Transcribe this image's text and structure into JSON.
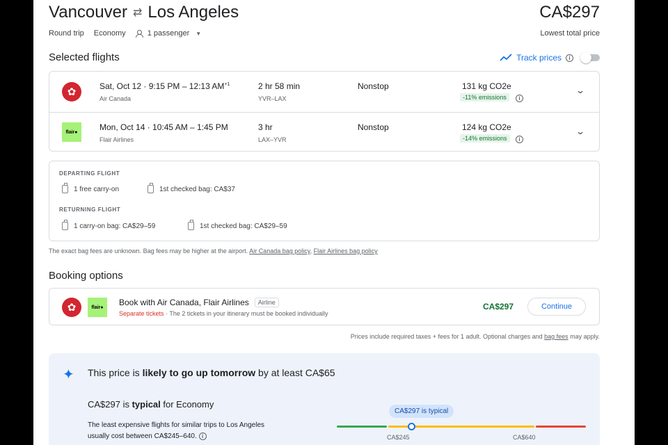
{
  "header": {
    "origin": "Vancouver",
    "destination": "Los Angeles",
    "swap_icon": "⇄",
    "price": "CA$297",
    "trip_type": "Round trip",
    "cabin": "Economy",
    "passengers": "1 passenger",
    "price_label": "Lowest total price"
  },
  "selected": {
    "title": "Selected flights",
    "track_label": "Track prices",
    "track_enabled": false,
    "flights": [
      {
        "date_time": "Sat, Oct 12 · 9:15 PM – 12:13 AM",
        "next_day": "+1",
        "airline": "Air Canada",
        "duration": "2 hr 58 min",
        "codes": "YVR–LAX",
        "stops": "Nonstop",
        "co2": "131 kg CO2e",
        "emissions": "-11% emissions",
        "logo": "air-canada-logo"
      },
      {
        "date_time": "Mon, Oct 14 · 10:45 AM – 1:45 PM",
        "next_day": "",
        "airline": "Flair Airlines",
        "duration": "3 hr",
        "codes": "LAX–YVR",
        "stops": "Nonstop",
        "co2": "124 kg CO2e",
        "emissions": "-14% emissions",
        "logo": "flair-logo"
      }
    ]
  },
  "logos": {
    "air_canada_glyph": "✿",
    "flair_text": "flair●"
  },
  "bags": {
    "departing_header": "DEPARTING FLIGHT",
    "departing_carry": "1 free carry-on",
    "departing_checked": "1st checked bag: CA$37",
    "returning_header": "RETURNING FLIGHT",
    "returning_carry": "1 carry-on bag: CA$29–59",
    "returning_checked": "1st checked bag: CA$29–59",
    "note": "The exact bag fees are unknown. Bag fees may be higher at the airport. ",
    "ac_policy": "Air Canada bag policy",
    "flair_policy": "Flair Airlines bag policy"
  },
  "booking": {
    "title": "Booking options",
    "book_with": "Book with Air Canada, Flair Airlines",
    "badge": "Airline",
    "separate": "Separate tickets",
    "separate_note": " · The 2 tickets in your itinerary must be booked individually",
    "price": "CA$297",
    "continue_label": "Continue",
    "fee_note_pre": "Prices include required taxes + fees for 1 adult. Optional charges and ",
    "fee_link": "bag fees",
    "fee_note_post": " may apply."
  },
  "insights": {
    "head_pre": "This price is ",
    "head_bold": "likely to go up tomorrow",
    "head_post": " by at least CA$65",
    "price_pre": "CA$297 is ",
    "price_bold": "typical",
    "price_post": " for Economy",
    "desc": "The least expensive flights for similar trips to Los Angeles usually cost between CA$245–640.",
    "pill": "CA$297 is typical",
    "low_label": "CA$245",
    "high_label": "CA$640",
    "range_low": 245,
    "range_high": 640,
    "current": 297,
    "colors": {
      "low": "#34a853",
      "typical": "#fbbc04",
      "high": "#ea4335"
    }
  }
}
